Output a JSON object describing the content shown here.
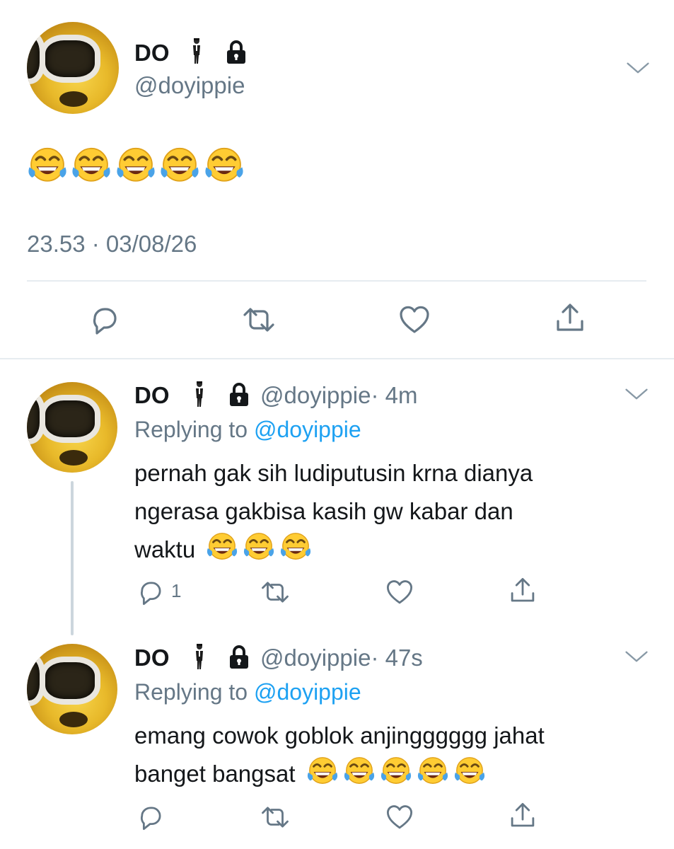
{
  "main_tweet": {
    "display_name": "DO",
    "name_icons": [
      "man-in-suit-levitating-icon",
      "lock-icon"
    ],
    "handle": "@doyippie",
    "body_emojis": 5,
    "timestamp": "23.53 · 03/08/26"
  },
  "replies": [
    {
      "display_name": "DO",
      "handle": "@doyippie",
      "time": "· 4m",
      "replying_prefix": "Replying to",
      "replying_handle": "@doyippie",
      "text_lines": [
        "pernah gak sih ludiputusin krna dianya",
        "ngerasa gakbisa kasih gw kabar dan",
        "waktu"
      ],
      "trailing_emojis": 3,
      "reply_count": "1"
    },
    {
      "display_name": "DO",
      "handle": "@doyippie",
      "time": "· 47s",
      "replying_prefix": "Replying to",
      "replying_handle": "@doyippie",
      "text_lines": [
        "emang cowok goblok anjingggggg jahat",
        "banget bangsat"
      ],
      "trailing_emojis": 5,
      "reply_count": ""
    }
  ],
  "colors": {
    "text": "#14171a",
    "muted": "#657786",
    "link": "#1da1f2",
    "icon": "#657786",
    "divider": "#e6ecf0",
    "thread_line": "#ccd6dd"
  }
}
